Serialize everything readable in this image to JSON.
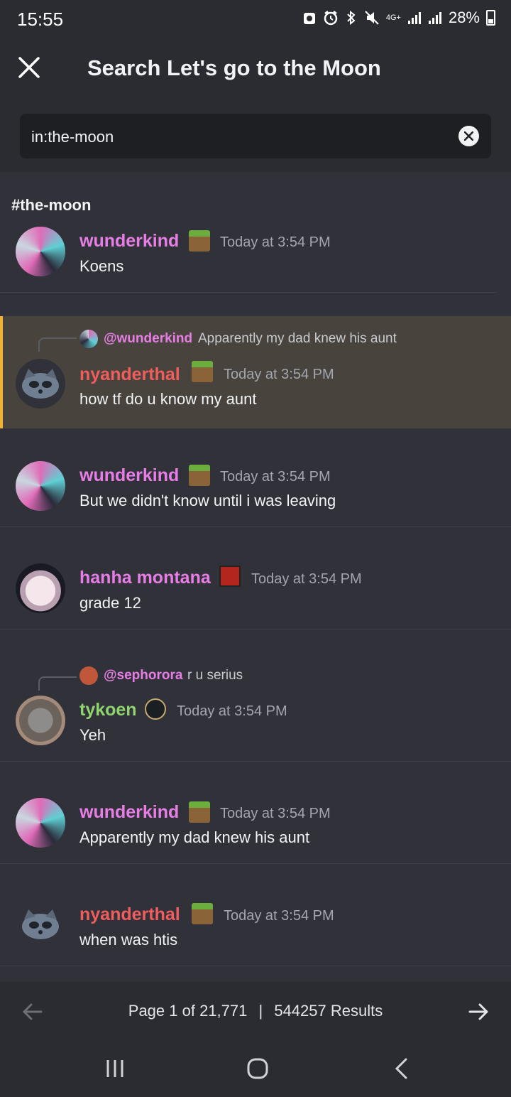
{
  "status_bar": {
    "time": "15:55",
    "network": "4G+",
    "battery": "28%"
  },
  "header": {
    "title": "Search Let's go to the Moon"
  },
  "search": {
    "value": "in:the-moon"
  },
  "channel_label": "#the-moon",
  "messages": [
    {
      "author": "wunderkind",
      "name_color": "#e77ee5",
      "badge": "minecraft-grass-block-icon",
      "timestamp": "Today at 3:54 PM",
      "content": "Koens"
    },
    {
      "author": "nyanderthal",
      "name_color": "#f05d5d",
      "badge": "minecraft-grass-block-icon",
      "timestamp": "Today at 3:54 PM",
      "content": "how tf do u know my aunt",
      "highlighted": true,
      "reply": {
        "author": "@wunderkind",
        "text": "Apparently my dad knew his aunt"
      }
    },
    {
      "author": "wunderkind",
      "name_color": "#e77ee5",
      "badge": "minecraft-grass-block-icon",
      "timestamp": "Today at 3:54 PM",
      "content": "But we didn't know until i was leaving"
    },
    {
      "author": "hanha montana",
      "name_color": "#e77ee5",
      "badge": "dota2-icon",
      "timestamp": "Today at 3:54 PM",
      "content": "grade 12"
    },
    {
      "author": "tykoen",
      "name_color": "#8fd46f",
      "badge": "league-of-legends-icon",
      "timestamp": "Today at 3:54 PM",
      "content": "Yeh",
      "reply": {
        "author": "@sephorora",
        "text": "r u serius"
      }
    },
    {
      "author": "wunderkind",
      "name_color": "#e77ee5",
      "badge": "minecraft-grass-block-icon",
      "timestamp": "Today at 3:54 PM",
      "content": "Apparently my dad knew his aunt"
    },
    {
      "author": "nyanderthal",
      "name_color": "#f05d5d",
      "badge": "minecraft-grass-block-icon",
      "timestamp": "Today at 3:54 PM",
      "content": "when was htis"
    }
  ],
  "pagination": {
    "page_text": "Page 1 of 21,771",
    "separator": "|",
    "results_text": "544257 Results"
  },
  "colors": {
    "background": "#303139",
    "header_bg": "#2b2c32",
    "highlight_bar": "#f0b232"
  }
}
